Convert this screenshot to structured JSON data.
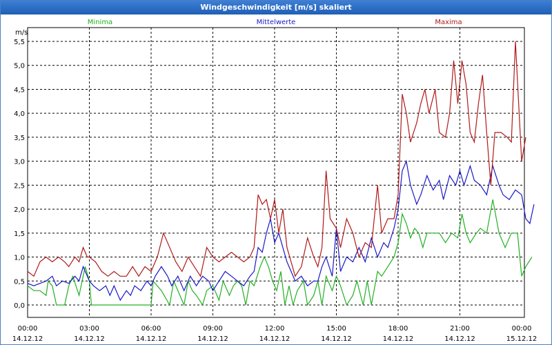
{
  "window": {
    "title": "Windgeschwindigkeit [m/s] skaliert"
  },
  "chart_data": {
    "type": "line",
    "title": "Windgeschwindigkeit [m/s] skaliert",
    "ylabel": "m/s",
    "xlabel": "",
    "ylim": [
      0,
      5.5
    ],
    "xlim_hours": [
      0,
      24
    ],
    "grid": true,
    "legend_position": "top",
    "y_ticks": [
      {
        "v": 0.0,
        "label": "0,0"
      },
      {
        "v": 0.5,
        "label": "0,5"
      },
      {
        "v": 1.0,
        "label": "1,0"
      },
      {
        "v": 1.5,
        "label": "1,5"
      },
      {
        "v": 2.0,
        "label": "2,0"
      },
      {
        "v": 2.5,
        "label": "2,5"
      },
      {
        "v": 3.0,
        "label": "3,0"
      },
      {
        "v": 3.5,
        "label": "3,5"
      },
      {
        "v": 4.0,
        "label": "4,0"
      },
      {
        "v": 4.5,
        "label": "4,5"
      },
      {
        "v": 5.0,
        "label": "5,0"
      },
      {
        "v": 5.5,
        "label": "5,5"
      }
    ],
    "x_ticks": [
      {
        "h": 0,
        "time": "00:00",
        "date": "14.12.12"
      },
      {
        "h": 3,
        "time": "03:00",
        "date": "14.12.12"
      },
      {
        "h": 6,
        "time": "06:00",
        "date": "14.12.12"
      },
      {
        "h": 9,
        "time": "09:00",
        "date": "14.12.12"
      },
      {
        "h": 12,
        "time": "12:00",
        "date": "14.12.12"
      },
      {
        "h": 15,
        "time": "15:00",
        "date": "14.12.12"
      },
      {
        "h": 18,
        "time": "18:00",
        "date": "14.12.12"
      },
      {
        "h": 21,
        "time": "21:00",
        "date": "14.12.12"
      },
      {
        "h": 24,
        "time": "00:00",
        "date": "15.12.12"
      }
    ],
    "series": [
      {
        "name": "Minima",
        "color": "#20b020",
        "points": [
          [
            0.0,
            0.4
          ],
          [
            0.3,
            0.3
          ],
          [
            0.6,
            0.3
          ],
          [
            0.9,
            0.2
          ],
          [
            1.0,
            0.5
          ],
          [
            1.2,
            0.4
          ],
          [
            1.4,
            0.0
          ],
          [
            1.8,
            0.0
          ],
          [
            2.0,
            0.4
          ],
          [
            2.2,
            0.6
          ],
          [
            2.5,
            0.2
          ],
          [
            2.8,
            0.8
          ],
          [
            3.0,
            0.5
          ],
          [
            3.1,
            0.0
          ],
          [
            4.0,
            0.0
          ],
          [
            5.0,
            0.0
          ],
          [
            6.0,
            0.0
          ],
          [
            6.1,
            0.5
          ],
          [
            6.5,
            0.3
          ],
          [
            6.9,
            0.0
          ],
          [
            7.1,
            0.5
          ],
          [
            7.4,
            0.2
          ],
          [
            7.6,
            0.0
          ],
          [
            7.8,
            0.5
          ],
          [
            8.0,
            0.3
          ],
          [
            8.2,
            0.2
          ],
          [
            8.5,
            0.0
          ],
          [
            8.7,
            0.3
          ],
          [
            9.0,
            0.4
          ],
          [
            9.3,
            0.1
          ],
          [
            9.5,
            0.5
          ],
          [
            9.8,
            0.2
          ],
          [
            10.0,
            0.4
          ],
          [
            10.2,
            0.5
          ],
          [
            10.4,
            0.4
          ],
          [
            10.6,
            0.0
          ],
          [
            10.8,
            0.5
          ],
          [
            11.0,
            0.4
          ],
          [
            11.3,
            0.8
          ],
          [
            11.5,
            1.0
          ],
          [
            11.7,
            0.8
          ],
          [
            11.9,
            0.5
          ],
          [
            12.1,
            0.3
          ],
          [
            12.3,
            0.7
          ],
          [
            12.5,
            0.0
          ],
          [
            12.7,
            0.4
          ],
          [
            12.9,
            0.0
          ],
          [
            13.1,
            0.3
          ],
          [
            13.4,
            0.5
          ],
          [
            13.6,
            0.0
          ],
          [
            13.9,
            0.2
          ],
          [
            14.1,
            0.5
          ],
          [
            14.3,
            0.0
          ],
          [
            14.5,
            0.6
          ],
          [
            14.8,
            0.3
          ],
          [
            15.0,
            0.6
          ],
          [
            15.2,
            0.4
          ],
          [
            15.5,
            0.0
          ],
          [
            15.8,
            0.2
          ],
          [
            16.0,
            0.5
          ],
          [
            16.3,
            0.0
          ],
          [
            16.5,
            0.5
          ],
          [
            16.7,
            0.0
          ],
          [
            17.0,
            0.7
          ],
          [
            17.2,
            0.6
          ],
          [
            17.5,
            0.8
          ],
          [
            17.8,
            1.0
          ],
          [
            18.0,
            1.3
          ],
          [
            18.2,
            1.9
          ],
          [
            18.4,
            1.7
          ],
          [
            18.6,
            1.4
          ],
          [
            18.8,
            1.6
          ],
          [
            19.0,
            1.5
          ],
          [
            19.2,
            1.2
          ],
          [
            19.4,
            1.5
          ],
          [
            19.7,
            1.5
          ],
          [
            20.0,
            1.5
          ],
          [
            20.3,
            1.3
          ],
          [
            20.6,
            1.5
          ],
          [
            20.9,
            1.4
          ],
          [
            21.1,
            1.9
          ],
          [
            21.3,
            1.5
          ],
          [
            21.5,
            1.3
          ],
          [
            21.8,
            1.5
          ],
          [
            22.0,
            1.6
          ],
          [
            22.3,
            1.5
          ],
          [
            22.6,
            2.2
          ],
          [
            22.9,
            1.5
          ],
          [
            23.2,
            1.2
          ],
          [
            23.5,
            1.5
          ],
          [
            23.8,
            1.5
          ],
          [
            24.0,
            0.6
          ],
          [
            24.2,
            0.8
          ],
          [
            24.5,
            1.0
          ]
        ]
      },
      {
        "name": "Mittelwerte",
        "color": "#1818c8",
        "points": [
          [
            0.0,
            0.45
          ],
          [
            0.3,
            0.4
          ],
          [
            0.6,
            0.45
          ],
          [
            0.9,
            0.5
          ],
          [
            1.2,
            0.6
          ],
          [
            1.4,
            0.4
          ],
          [
            1.7,
            0.5
          ],
          [
            2.0,
            0.45
          ],
          [
            2.3,
            0.6
          ],
          [
            2.5,
            0.5
          ],
          [
            2.7,
            0.8
          ],
          [
            2.9,
            0.6
          ],
          [
            3.0,
            0.5
          ],
          [
            3.2,
            0.4
          ],
          [
            3.5,
            0.3
          ],
          [
            3.8,
            0.4
          ],
          [
            4.0,
            0.2
          ],
          [
            4.2,
            0.4
          ],
          [
            4.5,
            0.1
          ],
          [
            4.8,
            0.3
          ],
          [
            5.0,
            0.2
          ],
          [
            5.2,
            0.4
          ],
          [
            5.5,
            0.3
          ],
          [
            5.8,
            0.5
          ],
          [
            6.0,
            0.4
          ],
          [
            6.2,
            0.6
          ],
          [
            6.5,
            0.8
          ],
          [
            6.8,
            0.6
          ],
          [
            7.0,
            0.4
          ],
          [
            7.3,
            0.6
          ],
          [
            7.6,
            0.3
          ],
          [
            7.9,
            0.6
          ],
          [
            8.2,
            0.4
          ],
          [
            8.5,
            0.6
          ],
          [
            8.8,
            0.5
          ],
          [
            9.0,
            0.3
          ],
          [
            9.3,
            0.5
          ],
          [
            9.6,
            0.7
          ],
          [
            9.9,
            0.6
          ],
          [
            10.2,
            0.5
          ],
          [
            10.5,
            0.4
          ],
          [
            10.8,
            0.6
          ],
          [
            11.0,
            0.7
          ],
          [
            11.2,
            1.2
          ],
          [
            11.4,
            1.1
          ],
          [
            11.6,
            1.5
          ],
          [
            11.8,
            1.8
          ],
          [
            12.0,
            1.3
          ],
          [
            12.2,
            1.5
          ],
          [
            12.4,
            1.2
          ],
          [
            12.6,
            0.9
          ],
          [
            12.8,
            0.7
          ],
          [
            13.0,
            0.5
          ],
          [
            13.3,
            0.6
          ],
          [
            13.6,
            0.4
          ],
          [
            13.9,
            0.5
          ],
          [
            14.1,
            0.5
          ],
          [
            14.3,
            0.8
          ],
          [
            14.5,
            1.0
          ],
          [
            14.8,
            0.6
          ],
          [
            15.0,
            1.6
          ],
          [
            15.2,
            0.7
          ],
          [
            15.5,
            1.0
          ],
          [
            15.8,
            0.9
          ],
          [
            16.1,
            1.2
          ],
          [
            16.4,
            0.9
          ],
          [
            16.7,
            1.4
          ],
          [
            17.0,
            1.0
          ],
          [
            17.3,
            1.3
          ],
          [
            17.5,
            1.2
          ],
          [
            17.8,
            1.6
          ],
          [
            18.0,
            2.0
          ],
          [
            18.2,
            2.8
          ],
          [
            18.4,
            3.0
          ],
          [
            18.6,
            2.5
          ],
          [
            18.9,
            2.1
          ],
          [
            19.1,
            2.3
          ],
          [
            19.4,
            2.7
          ],
          [
            19.7,
            2.4
          ],
          [
            20.0,
            2.6
          ],
          [
            20.2,
            2.2
          ],
          [
            20.5,
            2.7
          ],
          [
            20.8,
            2.5
          ],
          [
            21.0,
            2.8
          ],
          [
            21.2,
            2.5
          ],
          [
            21.5,
            2.9
          ],
          [
            21.7,
            2.6
          ],
          [
            22.0,
            2.5
          ],
          [
            22.3,
            2.3
          ],
          [
            22.6,
            2.9
          ],
          [
            22.9,
            2.5
          ],
          [
            23.1,
            2.3
          ],
          [
            23.4,
            2.2
          ],
          [
            23.7,
            2.4
          ],
          [
            24.0,
            2.3
          ],
          [
            24.2,
            1.8
          ],
          [
            24.4,
            1.7
          ],
          [
            24.6,
            2.1
          ]
        ]
      },
      {
        "name": "Maxima",
        "color": "#b01818",
        "points": [
          [
            0.0,
            0.7
          ],
          [
            0.3,
            0.6
          ],
          [
            0.6,
            0.9
          ],
          [
            0.9,
            1.0
          ],
          [
            1.2,
            0.9
          ],
          [
            1.5,
            1.0
          ],
          [
            1.8,
            0.9
          ],
          [
            2.0,
            0.8
          ],
          [
            2.3,
            1.0
          ],
          [
            2.5,
            0.9
          ],
          [
            2.7,
            1.2
          ],
          [
            2.9,
            1.0
          ],
          [
            3.0,
            1.0
          ],
          [
            3.3,
            0.9
          ],
          [
            3.6,
            0.7
          ],
          [
            3.9,
            0.6
          ],
          [
            4.2,
            0.7
          ],
          [
            4.5,
            0.6
          ],
          [
            4.8,
            0.6
          ],
          [
            5.1,
            0.8
          ],
          [
            5.4,
            0.6
          ],
          [
            5.7,
            0.8
          ],
          [
            6.0,
            0.7
          ],
          [
            6.3,
            1.0
          ],
          [
            6.6,
            1.5
          ],
          [
            6.9,
            1.2
          ],
          [
            7.2,
            0.9
          ],
          [
            7.5,
            0.7
          ],
          [
            7.8,
            1.0
          ],
          [
            8.1,
            0.8
          ],
          [
            8.4,
            0.6
          ],
          [
            8.7,
            1.2
          ],
          [
            9.0,
            1.0
          ],
          [
            9.3,
            0.9
          ],
          [
            9.6,
            1.0
          ],
          [
            9.9,
            1.1
          ],
          [
            10.2,
            1.0
          ],
          [
            10.5,
            0.9
          ],
          [
            10.8,
            1.0
          ],
          [
            11.0,
            1.2
          ],
          [
            11.2,
            2.3
          ],
          [
            11.4,
            2.1
          ],
          [
            11.6,
            2.2
          ],
          [
            11.8,
            1.8
          ],
          [
            12.0,
            2.2
          ],
          [
            12.2,
            1.5
          ],
          [
            12.4,
            2.0
          ],
          [
            12.6,
            1.2
          ],
          [
            12.8,
            0.9
          ],
          [
            13.0,
            0.6
          ],
          [
            13.3,
            0.8
          ],
          [
            13.6,
            1.4
          ],
          [
            13.9,
            1.0
          ],
          [
            14.1,
            0.8
          ],
          [
            14.3,
            1.2
          ],
          [
            14.5,
            2.8
          ],
          [
            14.7,
            1.8
          ],
          [
            15.0,
            1.6
          ],
          [
            15.2,
            1.2
          ],
          [
            15.5,
            1.8
          ],
          [
            15.8,
            1.5
          ],
          [
            16.1,
            1.0
          ],
          [
            16.4,
            1.3
          ],
          [
            16.7,
            1.2
          ],
          [
            17.0,
            2.5
          ],
          [
            17.2,
            1.5
          ],
          [
            17.5,
            1.8
          ],
          [
            17.8,
            1.8
          ],
          [
            18.0,
            2.3
          ],
          [
            18.2,
            4.4
          ],
          [
            18.4,
            4.0
          ],
          [
            18.6,
            3.4
          ],
          [
            18.9,
            3.8
          ],
          [
            19.1,
            4.2
          ],
          [
            19.3,
            4.5
          ],
          [
            19.5,
            4.0
          ],
          [
            19.8,
            4.5
          ],
          [
            20.0,
            3.6
          ],
          [
            20.3,
            3.5
          ],
          [
            20.5,
            4.0
          ],
          [
            20.7,
            5.1
          ],
          [
            20.9,
            4.2
          ],
          [
            21.1,
            5.1
          ],
          [
            21.3,
            4.6
          ],
          [
            21.5,
            3.6
          ],
          [
            21.7,
            3.4
          ],
          [
            21.9,
            4.2
          ],
          [
            22.1,
            4.8
          ],
          [
            22.3,
            3.6
          ],
          [
            22.5,
            2.5
          ],
          [
            22.7,
            3.6
          ],
          [
            23.0,
            3.6
          ],
          [
            23.3,
            3.5
          ],
          [
            23.5,
            3.4
          ],
          [
            23.7,
            5.5
          ],
          [
            24.0,
            3.0
          ],
          [
            24.2,
            3.5
          ]
        ]
      }
    ]
  }
}
